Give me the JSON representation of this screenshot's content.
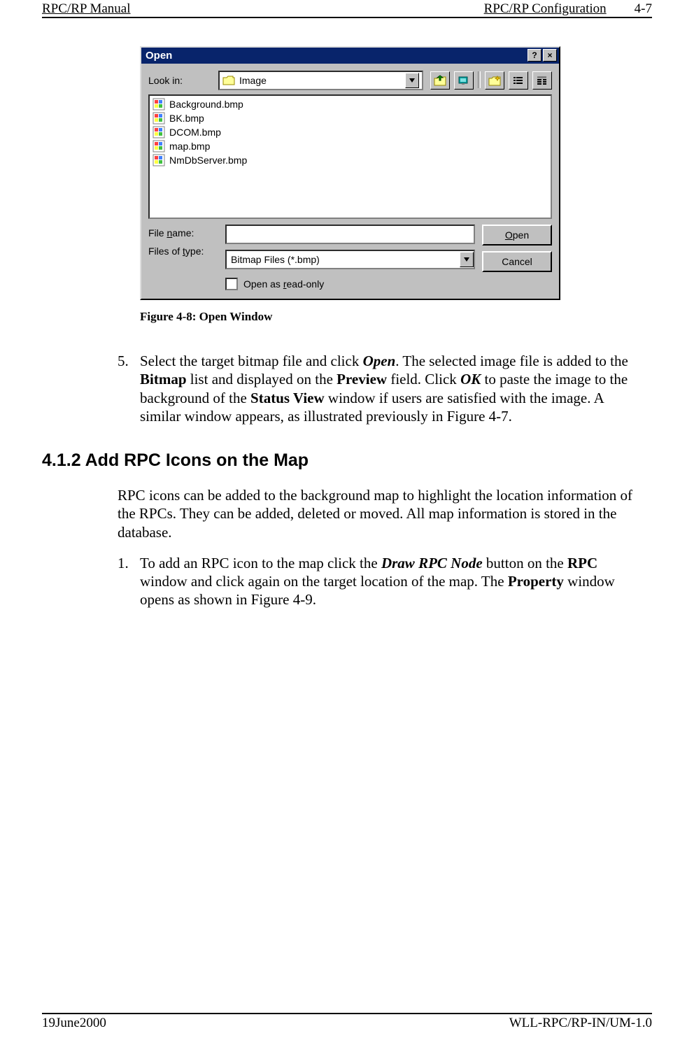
{
  "header": {
    "left": "RPC/RP Manual",
    "right_a": "RPC/RP Configuration",
    "right_b": "4-7"
  },
  "dialog": {
    "title": "Open",
    "lookin_label": "Look in:",
    "lookin_value": "Image",
    "files": [
      "Background.bmp",
      "BK.bmp",
      "DCOM.bmp",
      "map.bmp",
      "NmDbServer.bmp"
    ],
    "filename_label": "File name:",
    "filename_value": "",
    "filetype_label": "Files of type:",
    "filetype_value": "Bitmap Files (*.bmp)",
    "open_button": "Open",
    "cancel_button": "Cancel",
    "readonly_label": "Open as read-only"
  },
  "figure_caption": "Figure 4-8: Open Window",
  "step5": {
    "num": "5.",
    "text_a": "Select the target bitmap file and click ",
    "open": "Open",
    "text_b": ".  The selected image file is added to the ",
    "bitmap": "Bitmap",
    "text_c": " list and displayed on the ",
    "preview": "Preview",
    "text_d": " field.  Click ",
    "ok": "OK",
    "text_e": " to paste the image to the background of the ",
    "statusview": "Status View",
    "text_f": " window if users are satisfied with the image.  A similar window appears, as illustrated previously in Figure 4-7."
  },
  "section_heading": "4.1.2 Add RPC Icons on the Map",
  "section_intro": "RPC icons can be added to the background map to highlight the location information of the RPCs.  They can be added, deleted or moved.  All map information is stored in the database.",
  "step1": {
    "num": "1.",
    "text_a": "To add an RPC icon to the map click the ",
    "draw": "Draw RPC Node",
    "text_b": " button on the ",
    "rpc": "RPC",
    "text_c": " window and click again on the target location of the map.  The ",
    "property": "Property",
    "text_d": " window opens as shown in Figure 4-9."
  },
  "footer": {
    "left": "19June2000",
    "right": "WLL-RPC/RP-IN/UM-1.0"
  }
}
